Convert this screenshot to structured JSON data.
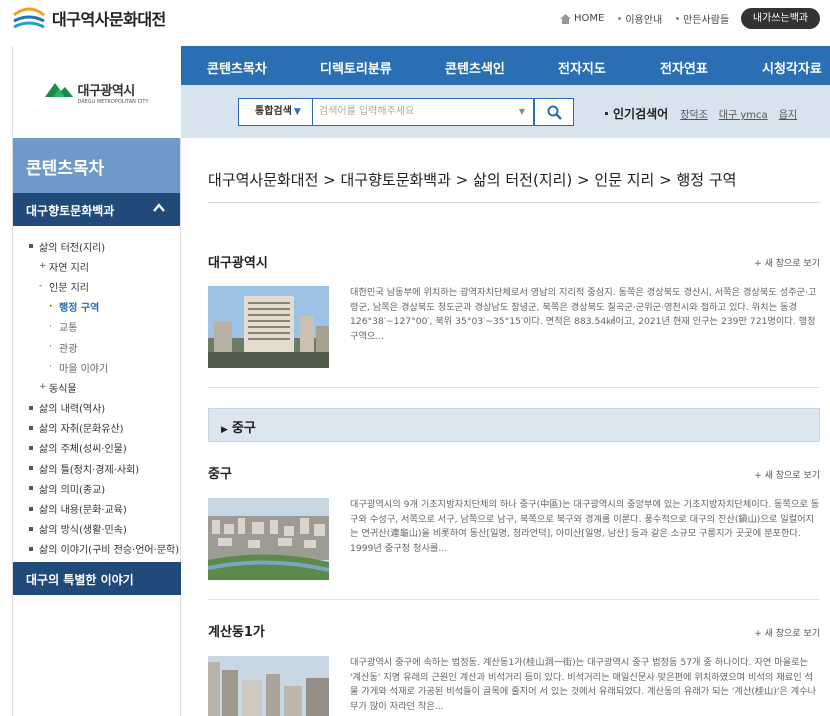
{
  "header": {
    "site_title": "대구역사문화대전",
    "links": [
      "HOME",
      "이용안내",
      "만든사람들"
    ],
    "my_book": "내가쓰는백과"
  },
  "brand": {
    "name": "대구광역시",
    "subtitle": "DAEGU METROPOLITAN CITY",
    "mark_text": "DAEGU"
  },
  "gnb": [
    "콘텐츠목차",
    "디렉토리분류",
    "콘텐츠색인",
    "전자지도",
    "전자연표",
    "시청각자료"
  ],
  "search": {
    "scope": "통합검색",
    "placeholder": "검색어를 입력해주세요",
    "popular_label": "인기검색어",
    "keywords": [
      "장덕조",
      "대구 ymca",
      "읍지"
    ]
  },
  "sidebar": {
    "title": "콘텐츠목차",
    "category": "대구향토문화백과",
    "tree": [
      {
        "label": "삶의 터전(지리)",
        "level": 1,
        "mark": "square"
      },
      {
        "label": "자연 지리",
        "level": 2,
        "mark": "+"
      },
      {
        "label": "인문 지리",
        "level": 2,
        "mark": "-"
      },
      {
        "label": "행정 구역",
        "level": 3,
        "mark": "·",
        "active": true
      },
      {
        "label": "교통",
        "level": 3,
        "mark": "·"
      },
      {
        "label": "관광",
        "level": 3,
        "mark": "·"
      },
      {
        "label": "마을 이야기",
        "level": 3,
        "mark": "·"
      },
      {
        "label": "동식물",
        "level": 2,
        "mark": "+"
      },
      {
        "label": "삶의 내력(역사)",
        "level": 1,
        "mark": "square"
      },
      {
        "label": "삶의 자취(문화유산)",
        "level": 1,
        "mark": "square"
      },
      {
        "label": "삶의 주체(성씨·인물)",
        "level": 1,
        "mark": "square"
      },
      {
        "label": "삶의 틀(정치·경제·사회)",
        "level": 1,
        "mark": "square"
      },
      {
        "label": "삶의 의미(종교)",
        "level": 1,
        "mark": "square"
      },
      {
        "label": "삶의 내용(문화·교육)",
        "level": 1,
        "mark": "square"
      },
      {
        "label": "삶의 방식(생활·민속)",
        "level": 1,
        "mark": "square"
      },
      {
        "label": "삶의 이야기(구비 전승·언어·문학)",
        "level": 1,
        "mark": "square"
      }
    ],
    "special": "대구의 특별한 이야기"
  },
  "main": {
    "breadcrumb": "대구역사문화대전 > 대구향토문화백과 > 삶의 터전(지리) > 인문 지리 > 행정 구역",
    "more_label": "+ 새 창으로 보기",
    "group_label": "중구",
    "entries": [
      {
        "title": "대구광역시",
        "text": "대한민국 남동부에 위치하는 광역자치단체로서 영남의 지리적 중심지. 동쪽은 경상북도 경산시, 서쪽은 경상북도 성주군·고령군, 남쪽은 경상북도 청도군과 경상남도 창녕군, 북쪽은 경상북도 칠곡군·군위군·영천시와 접하고 있다. 위치는 동경 126°38′~127°00′, 북위 35°03′~35°15′이다. 면적은 883.54㎢이고, 2021년 현재 인구는 239만 721명이다. 행정구역으..."
      },
      {
        "title": "중구",
        "text": "대구광역시의 9개 기초지방자치단체의 하나 중구(中區)는 대구광역시의 중앙부에 있는 기초지방자치단체이다. 동쪽으로 동구와 수성구, 서쪽으로 서구, 남쪽으로 남구, 북쪽으로 북구와 경계를 이룬다. 풍수적으로 대구의 진산(鎭山)으로 일컬어지는 연귀산(連龜山)을 비롯하여 동산[일명, 청라언덕], 아미산[일명, 남산] 등과 같은 소규모 구릉지가 곳곳에 분포한다. 1999년 중구청 청사를..."
      },
      {
        "title": "계산동1가",
        "text": "대구광역시 중구에 속하는 법정동. 계산동1가(桂山洞一街)는 대구광역시 중구 법정동 57개 중 하나이다. 자연 마을로는 '계산동' 지명 유래의 근원인 계산과 비석거리 등이 있다. 비석거리는 매일신문사 맞은편에 위치하였으며 비석의 재료인 석물 가게와 석재로 가공된 비석들이 골목에 줄지어 서 있는 것에서 유래되었다. 계산동의 유래가 되는 '계산(桂山)'은 계수나무가 많이 자라던 작은..."
      }
    ]
  },
  "colors": {
    "nav_blue": "#2a6fb3",
    "search_bg": "#d7e3ee",
    "side_title": "#6e99c8",
    "side_dark": "#1f4a7a",
    "group_bg": "#dbe6f1"
  }
}
